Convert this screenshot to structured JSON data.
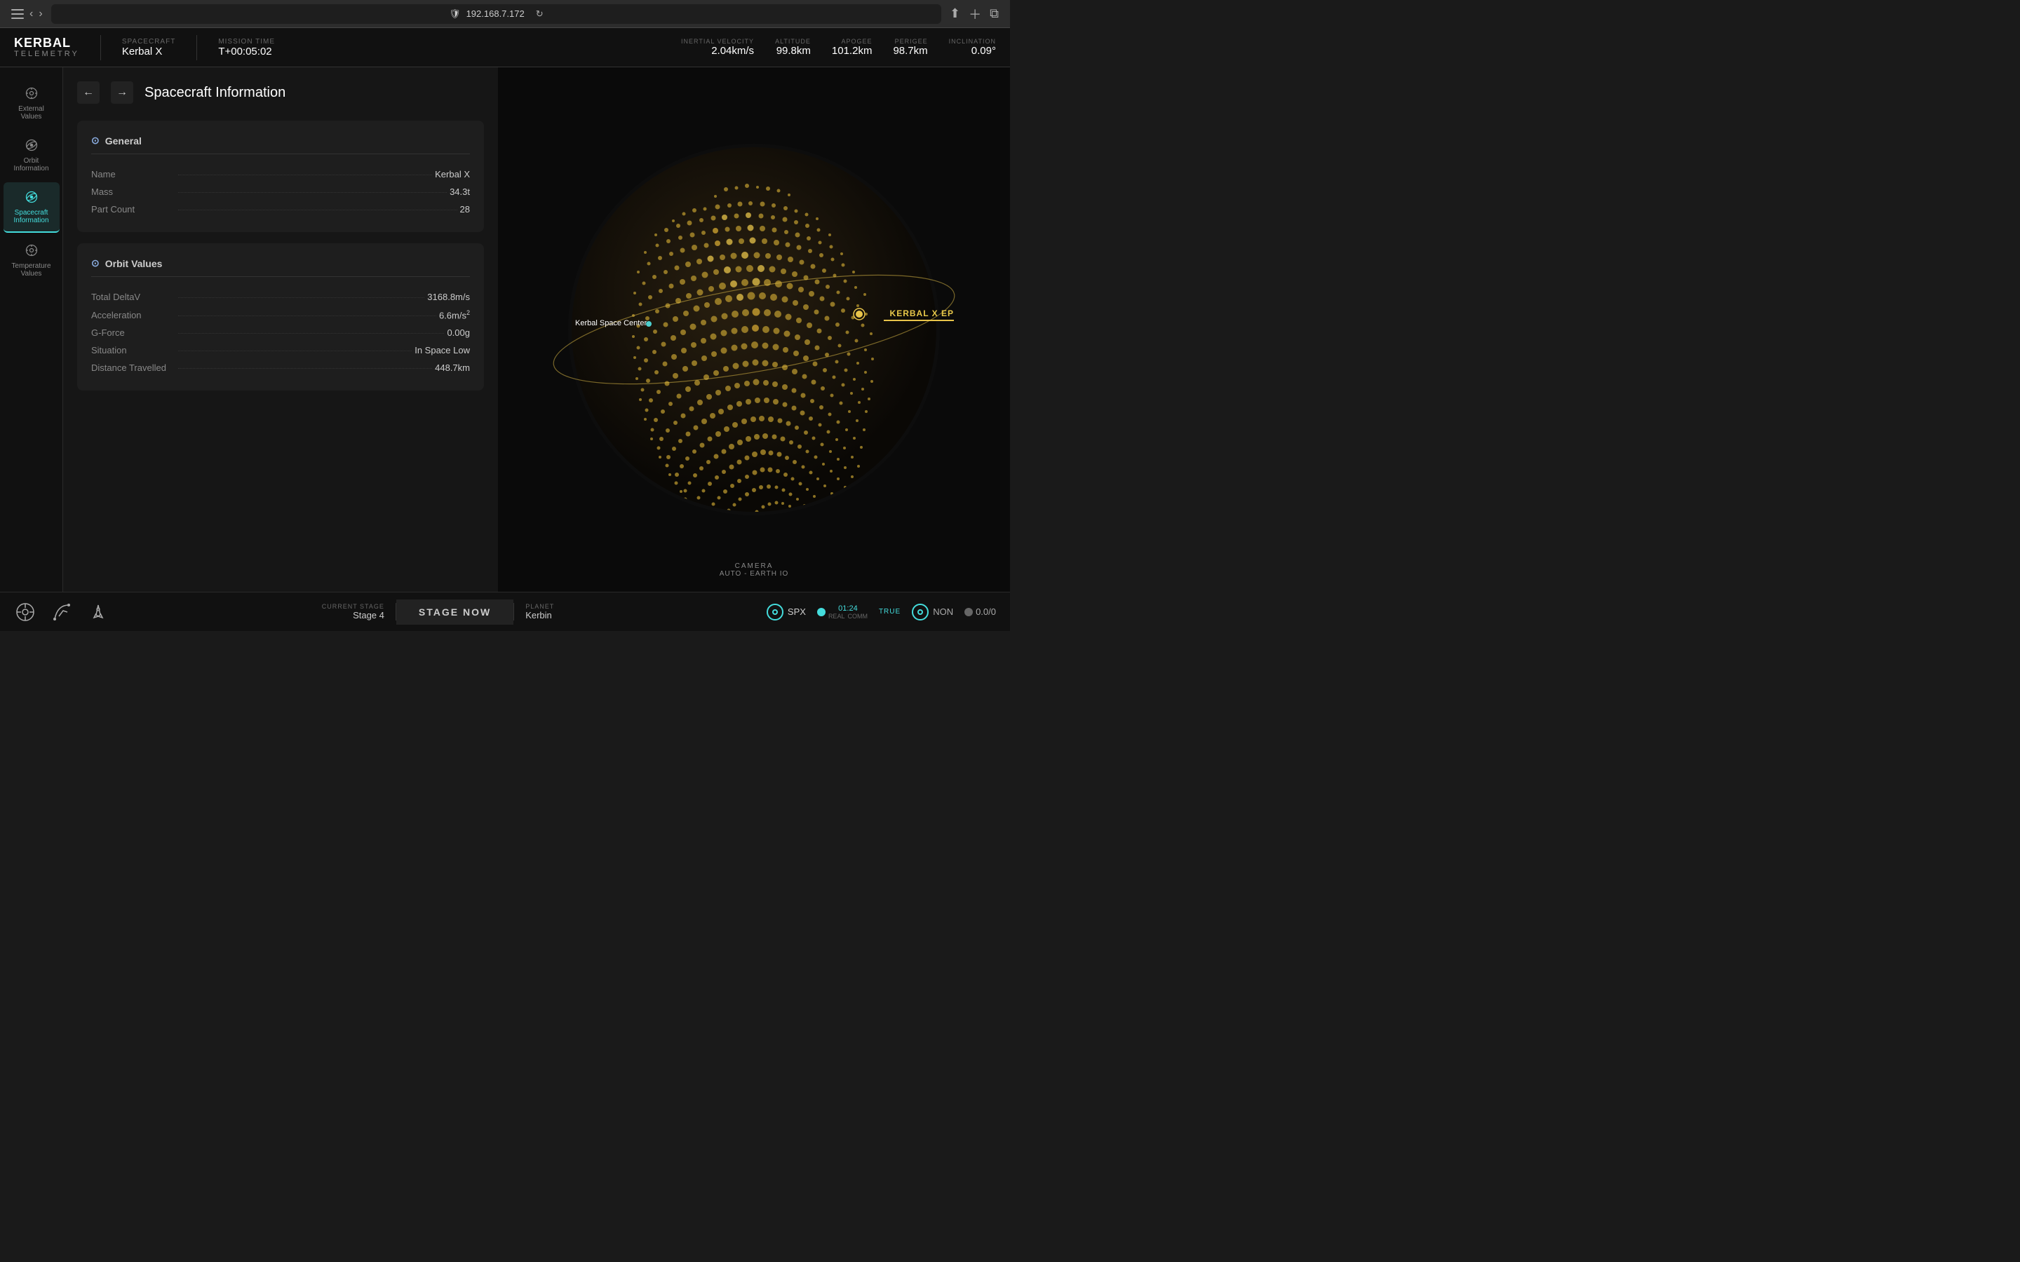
{
  "browser": {
    "url": "192.168.7.172",
    "reload_icon": "↻"
  },
  "header": {
    "logo_top": "KERBAL",
    "logo_bottom": "TELEMETRY",
    "spacecraft_label": "SPACECRAFT",
    "spacecraft_name": "Kerbal X",
    "mission_time_label": "MISSION TIME",
    "mission_time": "T+00:05:02",
    "stats": [
      {
        "label": "INERTIAL VELOCITY",
        "value": "2.04km/s"
      },
      {
        "label": "ALTITUDE",
        "value": "99.8km"
      },
      {
        "label": "APOGEE",
        "value": "101.2km"
      },
      {
        "label": "PERIGEE",
        "value": "98.7km"
      },
      {
        "label": "INCLINATION",
        "value": "0.09°"
      }
    ]
  },
  "sidebar": {
    "items": [
      {
        "id": "external-values",
        "label": "External Values",
        "active": false
      },
      {
        "id": "orbit-information",
        "label": "Orbit Information",
        "active": false
      },
      {
        "id": "spacecraft-information",
        "label": "Spacecraft Information",
        "active": true
      },
      {
        "id": "temperature-values",
        "label": "Temperature Values",
        "active": false
      }
    ]
  },
  "panel": {
    "title": "Spacecraft Information",
    "back_btn": "←",
    "forward_btn": "→",
    "general": {
      "title": "General",
      "rows": [
        {
          "label": "Name",
          "value": "Kerbal X"
        },
        {
          "label": "Mass",
          "value": "34.3t"
        },
        {
          "label": "Part Count",
          "value": "28"
        }
      ]
    },
    "orbit_values": {
      "title": "Orbit Values",
      "rows": [
        {
          "label": "Total DeltaV",
          "value": "3168.8m/s"
        },
        {
          "label": "Acceleration",
          "value": "6.6m/s²"
        },
        {
          "label": "G-Force",
          "value": "0.00g"
        },
        {
          "label": "Situation",
          "value": "In Space Low"
        },
        {
          "label": "Distance Travelled",
          "value": "448.7km"
        }
      ]
    }
  },
  "globe": {
    "ksc_label": "Kerbal Space Center",
    "spacecraft_label": "KERBAL X EP",
    "camera_label": "CAMERA",
    "camera_mode": "Auto - Earth IO"
  },
  "bottom_bar": {
    "current_stage_label": "CURRENT STAGE",
    "current_stage_value": "Stage 4",
    "stage_now_btn": "STAGE NOW",
    "planet_label": "PLANET",
    "planet_value": "Kerbin",
    "spx_label": "SPX",
    "time_real": "01:24",
    "time_label_top": "REAL",
    "time_label_bottom": "COMM",
    "true_label": "TRUE",
    "non_label": "NON",
    "score": "0.0/0"
  }
}
